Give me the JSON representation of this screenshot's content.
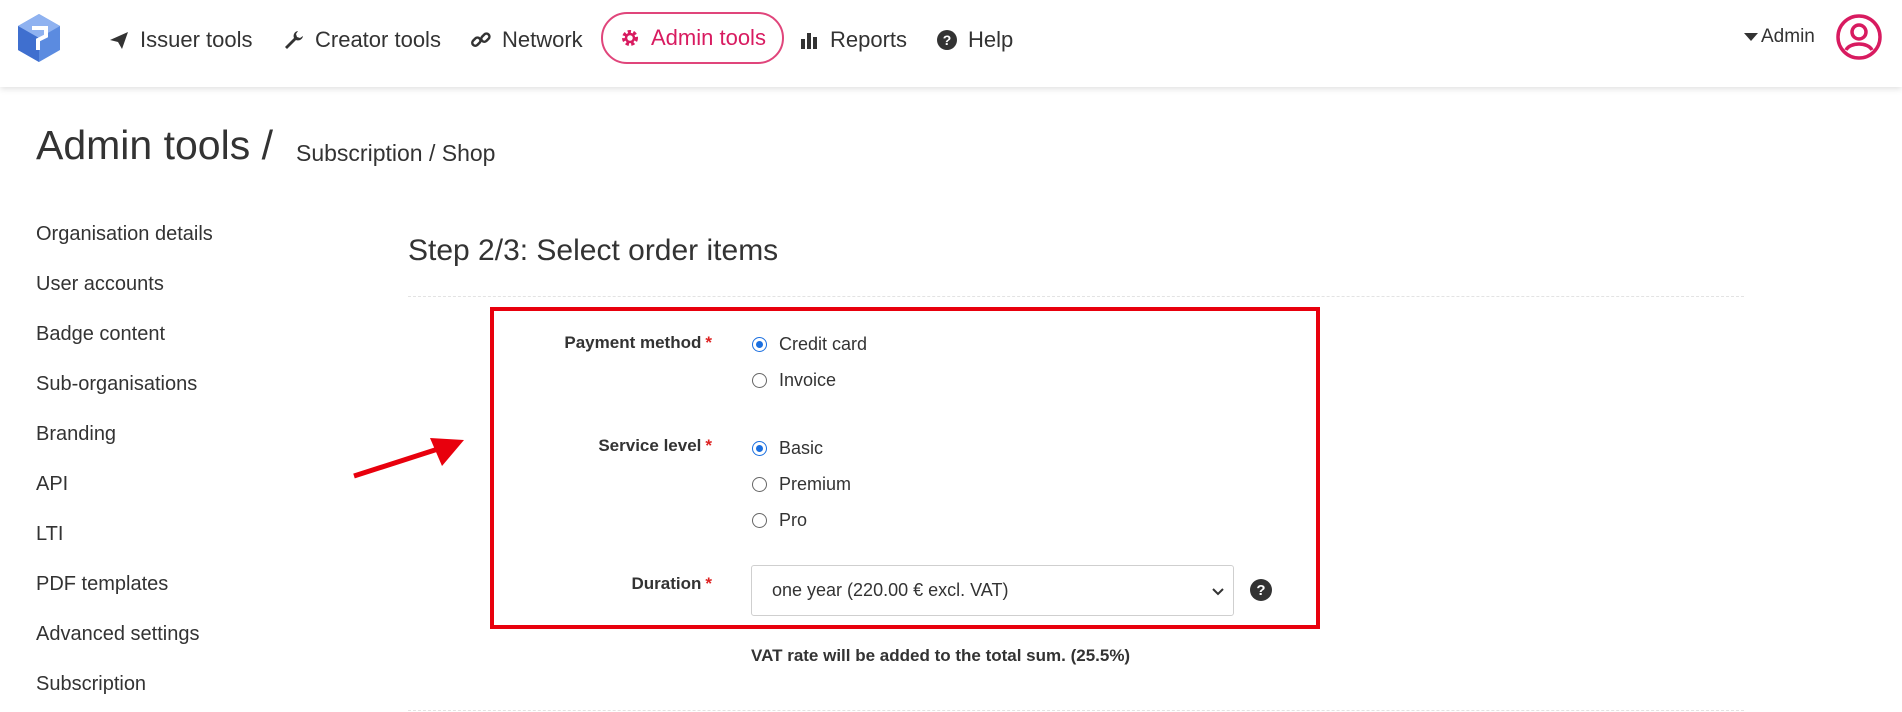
{
  "nav": {
    "items": [
      {
        "label": "Issuer tools",
        "icon": "paper-plane-icon"
      },
      {
        "label": "Creator tools",
        "icon": "wrench-icon"
      },
      {
        "label": "Network",
        "icon": "link-icon"
      },
      {
        "label": "Admin tools",
        "icon": "gear-icon",
        "active": true
      },
      {
        "label": "Reports",
        "icon": "bar-chart-icon"
      },
      {
        "label": "Help",
        "icon": "question-circle-icon"
      }
    ],
    "user_menu_label": "Admin",
    "active_color": "#d81b60"
  },
  "header": {
    "title": "Admin tools /",
    "breadcrumb": "Subscription / Shop"
  },
  "sidebar": {
    "items": [
      "Organisation details",
      "User accounts",
      "Badge content",
      "Sub-organisations",
      "Branding",
      "API",
      "LTI",
      "PDF templates",
      "Advanced settings",
      "Subscription"
    ]
  },
  "main": {
    "step_title": "Step 2/3: Select order items",
    "payment_method": {
      "label": "Payment method",
      "required_mark": "*",
      "options": [
        {
          "label": "Credit card",
          "selected": true
        },
        {
          "label": "Invoice",
          "selected": false
        }
      ]
    },
    "service_level": {
      "label": "Service level",
      "required_mark": "*",
      "options": [
        {
          "label": "Basic",
          "selected": true
        },
        {
          "label": "Premium",
          "selected": false
        },
        {
          "label": "Pro",
          "selected": false
        }
      ]
    },
    "duration": {
      "label": "Duration",
      "required_mark": "*",
      "selected": "one year (220.00 € excl. VAT)"
    },
    "vat_note": "VAT rate will be added to the total sum. (25.5%)",
    "highlight_color": "#e8000d"
  }
}
